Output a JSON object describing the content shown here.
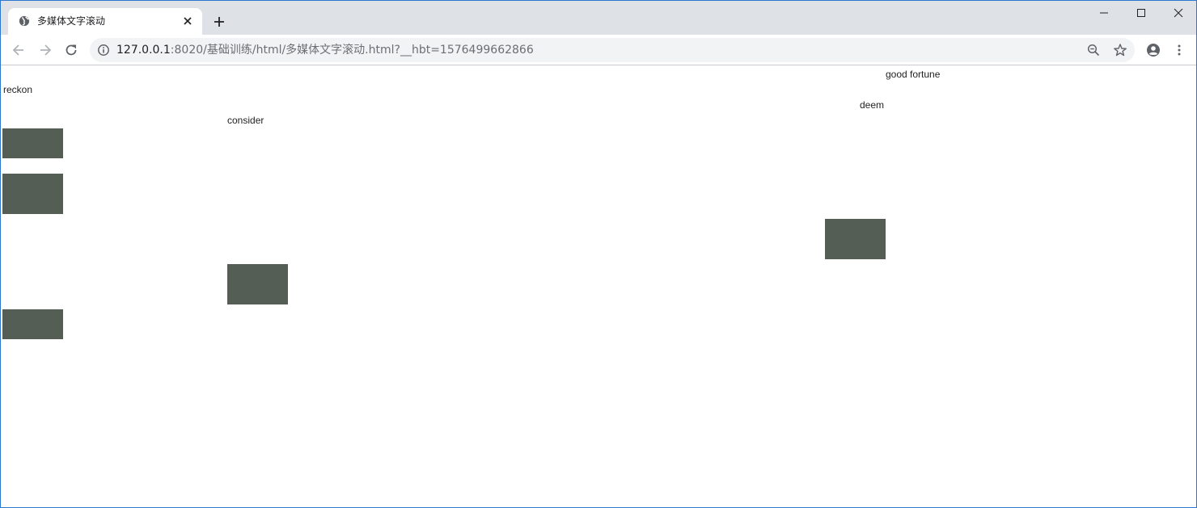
{
  "browser": {
    "tab": {
      "title": "多媒体文字滚动"
    },
    "url": {
      "host": "127.0.0.1",
      "path": ":8020/基础训练/html/多媒体文字滚动.html?__hbt=1576499662866"
    }
  },
  "page": {
    "words": {
      "reckon": "reckon",
      "consider": "consider",
      "deem": "deem",
      "good_fortune": "good fortune"
    }
  },
  "colors": {
    "block": "#555e55",
    "tabstrip": "#dee1e6",
    "omnibox": "#f1f3f4"
  },
  "icons": [
    "globe-icon",
    "close-icon",
    "plus-icon",
    "minimize-icon",
    "maximize-icon",
    "window-close-icon",
    "back-arrow-icon",
    "forward-arrow-icon",
    "reload-icon",
    "info-icon",
    "zoom-out-icon",
    "star-icon",
    "profile-icon",
    "menu-dots-icon"
  ]
}
